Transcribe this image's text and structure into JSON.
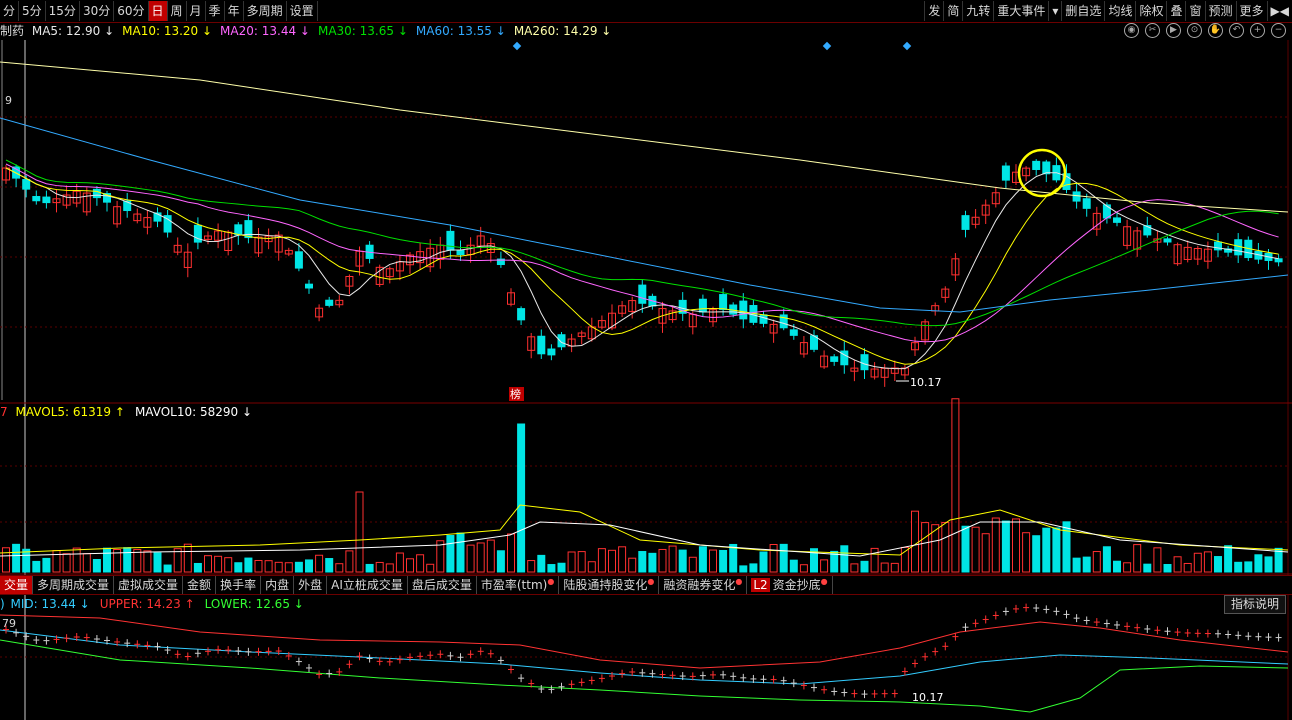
{
  "toolbar": {
    "left": [
      "分",
      "5分",
      "15分",
      "30分",
      "60分",
      "日",
      "周",
      "月",
      "季",
      "年",
      "多周期",
      "设置"
    ],
    "active_index": 5,
    "right": [
      "发",
      "简",
      "九转",
      "重大事件",
      "▾",
      "删自选",
      "均线",
      "除权",
      "叠",
      "窗",
      "预测",
      "更多",
      "▶◀"
    ]
  },
  "ma_bar": {
    "stock_fragment": "制药",
    "items": [
      {
        "label": "MA5: 12.90",
        "arrow": "↓",
        "color": "#e8e8e8"
      },
      {
        "label": "MA10: 13.20",
        "arrow": "↓",
        "color": "#ffff00"
      },
      {
        "label": "MA20: 13.44",
        "arrow": "↓",
        "color": "#ff66ff"
      },
      {
        "label": "MA30: 13.65",
        "arrow": "↓",
        "color": "#00e000"
      },
      {
        "label": "MA60: 13.55",
        "arrow": "↓",
        "color": "#33aaff"
      },
      {
        "label": "MA260: 14.29",
        "arrow": "↓",
        "color": "#ffffaa"
      }
    ]
  },
  "price_chart": {
    "axis_fragment": "9",
    "low_label": "10.17",
    "marker_label": "榜"
  },
  "vol_bar": {
    "lead": "7",
    "items": [
      {
        "label": "MAVOL5: 61319",
        "arrow": "↑",
        "color": "#ffff00"
      },
      {
        "label": "MAVOL10: 58290",
        "arrow": "↓",
        "color": "#ffffff"
      }
    ]
  },
  "indicator_tabs": [
    {
      "label": "交量",
      "active": true,
      "dot": false
    },
    {
      "label": "多周期成交量",
      "active": false,
      "dot": false
    },
    {
      "label": "虚拟成交量",
      "active": false,
      "dot": false
    },
    {
      "label": "金额",
      "active": false,
      "dot": false
    },
    {
      "label": "换手率",
      "active": false,
      "dot": false
    },
    {
      "label": "内盘",
      "active": false,
      "dot": false
    },
    {
      "label": "外盘",
      "active": false,
      "dot": false
    },
    {
      "label": "AI立桩成交量",
      "active": false,
      "dot": false
    },
    {
      "label": "盘后成交量",
      "active": false,
      "dot": false
    },
    {
      "label": "市盈率(ttm)",
      "active": false,
      "dot": true
    },
    {
      "label": "陆股通持股变化",
      "active": false,
      "dot": true
    },
    {
      "label": "融资融券变化",
      "active": false,
      "dot": true
    },
    {
      "label": "资金抄底",
      "active": false,
      "dot": true,
      "badge": "L2"
    }
  ],
  "boll_bar": {
    "lead": ")",
    "items": [
      {
        "label": "MID: 13.44",
        "arrow": "↓",
        "color": "#33ccff"
      },
      {
        "label": "UPPER: 14.23",
        "arrow": "↑",
        "color": "#ff3333"
      },
      {
        "label": "LOWER: 12.65",
        "arrow": "↓",
        "color": "#33ff33"
      }
    ],
    "axis_fragment": "79",
    "low_label": "10.17"
  },
  "help_button": "指标说明",
  "colors": {
    "up": "#ff3030",
    "down": "#00e5e5",
    "grid": "#5a0000"
  },
  "chart_data": {
    "type": "candlestick",
    "title": "",
    "ma_values_latest": {
      "MA5": 12.9,
      "MA10": 13.2,
      "MA20": 13.44,
      "MA30": 13.65,
      "MA60": 13.55,
      "MA260": 14.29
    },
    "low": 10.17,
    "volume_ma_latest": {
      "MAVOL5": 61319,
      "MAVOL10": 58290
    },
    "boll_latest": {
      "MID": 13.44,
      "UPPER": 14.23,
      "LOWER": 12.65
    }
  }
}
